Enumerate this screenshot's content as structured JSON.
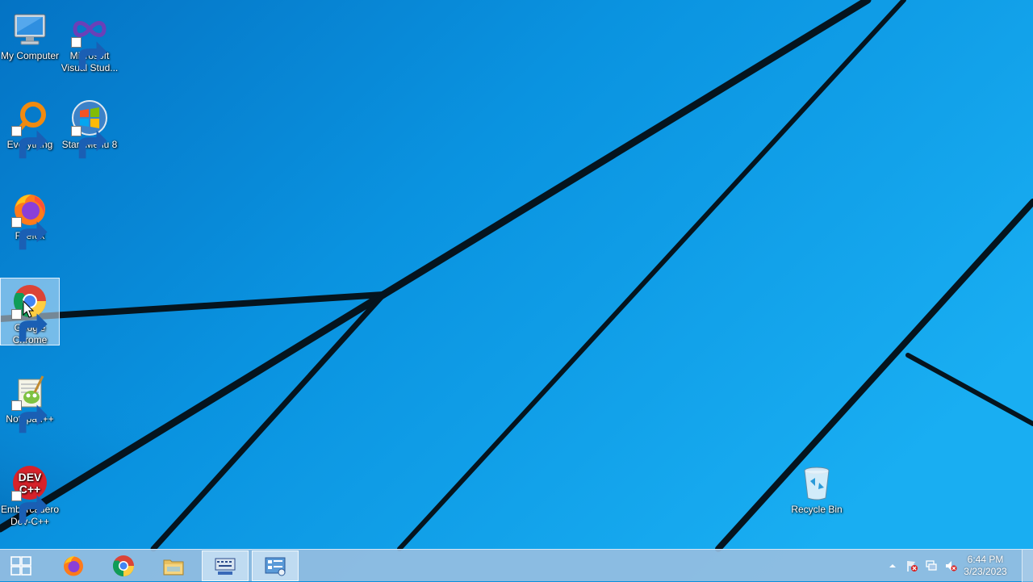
{
  "desktop": {
    "icons": [
      {
        "label": "My Computer",
        "icon": "my-computer-icon"
      },
      {
        "label": "Microsoft Visual Stud...",
        "icon": "visual-studio-icon"
      },
      {
        "label": "Everything",
        "icon": "everything-search-icon"
      },
      {
        "label": "Start Menu 8",
        "icon": "start-menu-8-icon"
      },
      {
        "label": "Firefox",
        "icon": "firefox-icon"
      },
      {
        "label": "Google Chrome",
        "icon": "chrome-icon",
        "selected": true
      },
      {
        "label": "Notepad++",
        "icon": "notepad-plus-plus-icon"
      },
      {
        "label": "Embarcadero Dev-C++",
        "icon": "dev-cpp-icon"
      },
      {
        "label": "Recycle Bin",
        "icon": "recycle-bin-icon"
      }
    ]
  },
  "taskbar": {
    "start": {
      "icon": "windows-start-icon"
    },
    "pinned": [
      {
        "name": "Firefox",
        "icon": "firefox-icon"
      },
      {
        "name": "Google Chrome",
        "icon": "chrome-icon"
      },
      {
        "name": "File Explorer",
        "icon": "folder-icon"
      },
      {
        "name": "On-Screen Keyboard",
        "icon": "keyboard-icon"
      },
      {
        "name": "Control Panel",
        "icon": "control-panel-icon"
      }
    ],
    "tray": {
      "icons": [
        "show-hidden-icons-chevron",
        "action-center-flag-icon",
        "network-icon",
        "volume-muted-icon"
      ]
    },
    "clock": {
      "time": "6:44 PM",
      "date": "3/23/2023"
    }
  },
  "colors": {
    "wallpaper": "#0a8fdc",
    "taskbar": "#96bee1"
  }
}
